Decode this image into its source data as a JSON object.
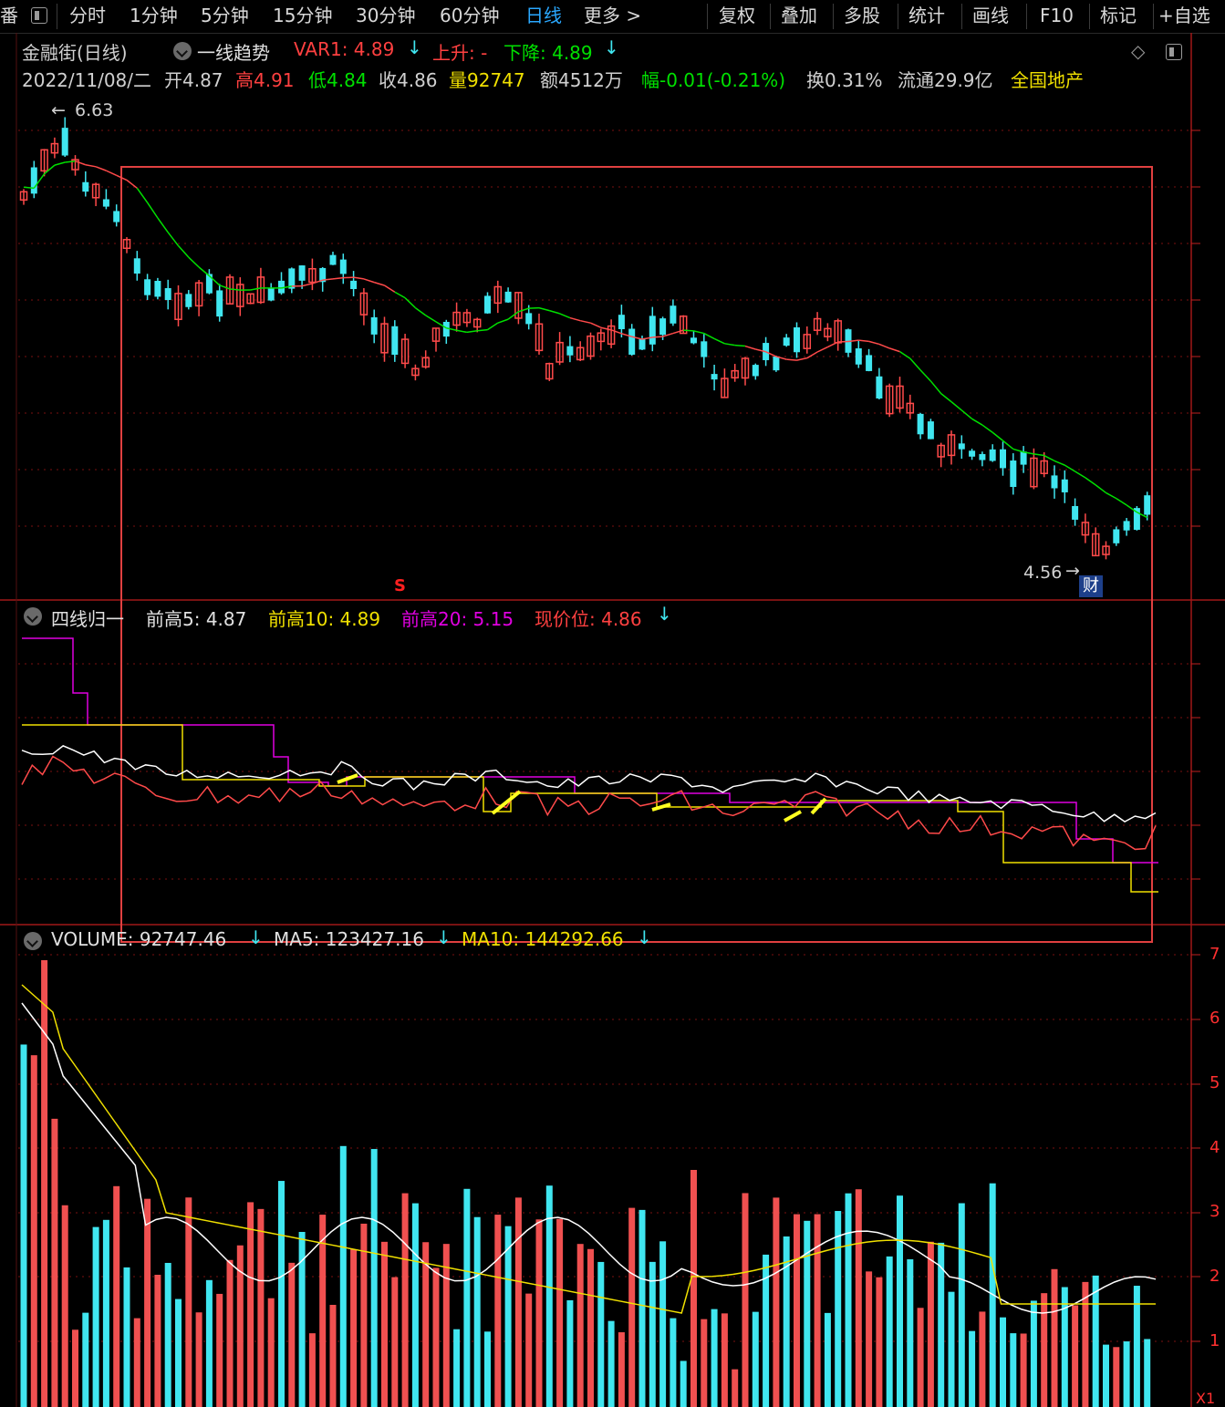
{
  "toolbar": {
    "cut_left": "番",
    "items": [
      "分时",
      "1分钟",
      "5分钟",
      "15分钟",
      "30分钟",
      "60分钟",
      "日线",
      "更多 >"
    ],
    "active_index": 6,
    "right_items": [
      "复权",
      "叠加",
      "多股",
      "统计",
      "画线",
      "F10",
      "标记",
      "+自选"
    ]
  },
  "main_panel": {
    "stock_title": "金融街(日线)",
    "indicator_name": "一线趋势",
    "var1": "VAR1: 4.89",
    "up": "上升: -",
    "down": "下降: 4.89",
    "bar_info": {
      "date": "2022/11/08/二",
      "open": "开4.87",
      "high": "高4.91",
      "low": "低4.84",
      "close": "收4.86",
      "vol": "量92747",
      "amount": "额4512万",
      "change": "幅-0.01(-0.21%)",
      "turnover": "换0.31%",
      "float": "流通29.9亿",
      "sector": "全国地产"
    },
    "high_marker": "6.63",
    "low_marker": "4.56",
    "s_marker": "S",
    "cai_badge": "财"
  },
  "mid_panel": {
    "name": "四线归一",
    "pre_high5": "前高5: 4.87",
    "pre_high10": "前高10: 4.89",
    "pre_high20": "前高20: 5.15",
    "current_pos": "现价位: 4.86"
  },
  "vol_panel": {
    "volume": "VOLUME: 92747.46",
    "ma5": "MA5: 123427.16",
    "ma10": "MA10: 144292.66",
    "axis_labels": [
      "7",
      "6",
      "5",
      "4",
      "3",
      "2",
      "1"
    ],
    "corner": "X1"
  },
  "colors": {
    "up": "#ff4a4a",
    "down": "#40e6f0",
    "ma_green": "#00e000",
    "yellow": "#f0e000",
    "magenta": "#e000e0",
    "white": "#ffffff",
    "grid": "#7a1010",
    "highlight_box": "#e04040",
    "active_tab": "#2aa8ff"
  }
}
